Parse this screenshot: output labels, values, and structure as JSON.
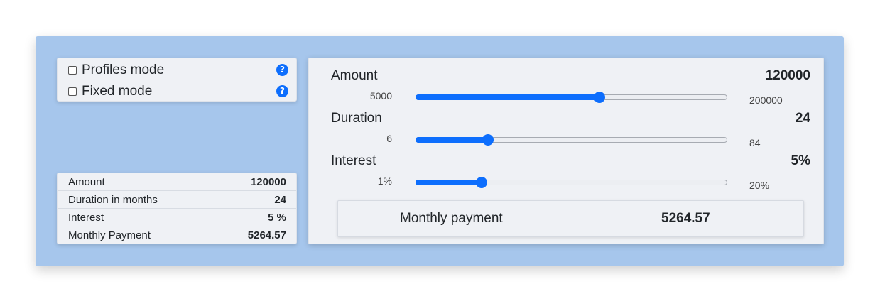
{
  "modes": [
    {
      "label": "Profiles mode",
      "checked": false,
      "icon": "question-circle-icon"
    },
    {
      "label": "Fixed mode",
      "checked": false,
      "icon": "question-circle-icon"
    }
  ],
  "summary": [
    {
      "label": "Amount",
      "value": "120000"
    },
    {
      "label": "Duration in months",
      "value": "24"
    },
    {
      "label": "Interest",
      "value": "5 %"
    },
    {
      "label": "Monthly Payment",
      "value": "5264.57"
    }
  ],
  "params": {
    "amount": {
      "title": "Amount",
      "value": "120000",
      "min": "5000",
      "max": "200000",
      "fraction": 0.59
    },
    "duration": {
      "title": "Duration",
      "value": "24",
      "min": "6",
      "max": "84",
      "fraction": 0.23
    },
    "interest": {
      "title": "Interest",
      "value": "5%",
      "min": "1%",
      "max": "20%",
      "fraction": 0.21
    }
  },
  "payment": {
    "label": "Monthly payment",
    "value": "5264.57"
  },
  "colors": {
    "accent": "#0d6efd",
    "background": "#a6c6ec",
    "panel": "#eff1f5"
  }
}
